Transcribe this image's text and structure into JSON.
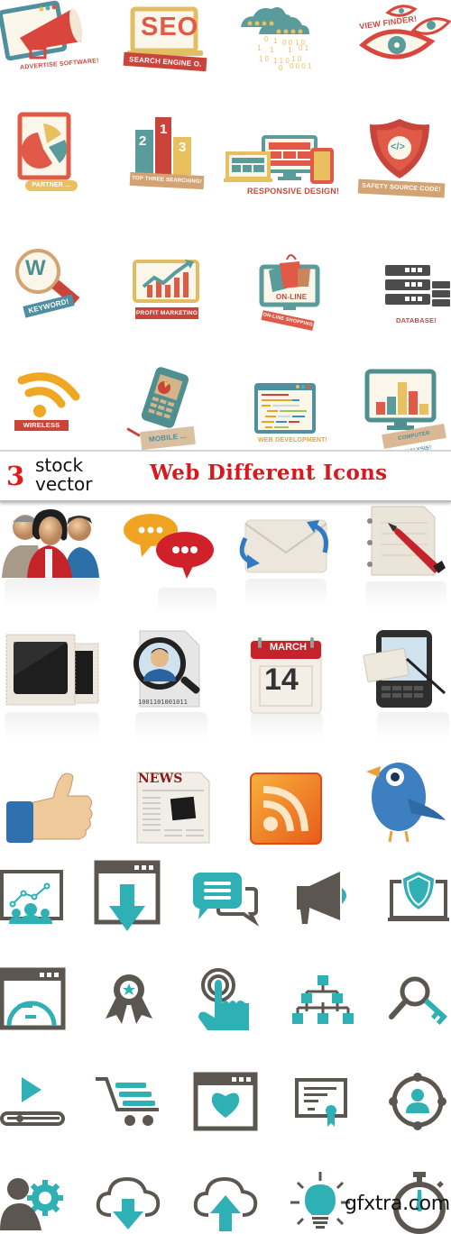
{
  "header": {
    "brand_number": "3",
    "brand_text_line1": "stock",
    "brand_text_line2": "vector",
    "title": "Web Different Icons"
  },
  "watermark": "gfxtra.com",
  "colors": {
    "retro_red": "#e05a47",
    "retro_teal": "#4f9a9b",
    "retro_yellow": "#e9c05f",
    "retro_tan": "#d9b48a",
    "flat_dark": "#5b5650",
    "flat_teal": "#2fb0b4",
    "title_red": "#d71920"
  },
  "retro_icons": [
    {
      "icon": "megaphone-window-icon",
      "label": "ADVERTISE SOFTWARE!"
    },
    {
      "icon": "seo-laptop-icon",
      "label": "SEARCH ENGINE O.",
      "screen_text": "SEO"
    },
    {
      "icon": "binary-cloud-icon",
      "label": ""
    },
    {
      "icon": "eyes-icon",
      "label": "VIEW FINDER!"
    },
    {
      "icon": "tablet-pie-chart-icon",
      "label": "PARTNER ..."
    },
    {
      "icon": "podium-icon",
      "label": "TOP THREE SEARCHING!",
      "ranks": [
        "2",
        "1",
        "3"
      ]
    },
    {
      "icon": "responsive-devices-icon",
      "label": "RESPONSIVE DESIGN!"
    },
    {
      "icon": "shield-code-icon",
      "label": "SAFETY SOURCE CODE!",
      "code": "</>"
    },
    {
      "icon": "magnifier-w-icon",
      "label": "KEYWORD!",
      "letter": "W"
    },
    {
      "icon": "growth-chart-laptop-icon",
      "label": "PROFIT MARKETING"
    },
    {
      "icon": "shopping-monitor-icon",
      "label": "ON-LINE SHOPPING",
      "screen_text": "ON-LINE"
    },
    {
      "icon": "database-servers-icon",
      "label": "DATABASE!"
    },
    {
      "icon": "wifi-icon",
      "label": "WIRELESS"
    },
    {
      "icon": "mobile-phone-icon",
      "label": "MOBILE ..."
    },
    {
      "icon": "code-window-icon",
      "label": "WEB DEVELOPMENT!"
    },
    {
      "icon": "monitor-bar-chart-icon",
      "label": "COMPUTER ANALYSIS!"
    }
  ],
  "glossy_icons": [
    {
      "icon": "people-group-icon"
    },
    {
      "icon": "chat-bubbles-icon"
    },
    {
      "icon": "mail-sync-icon"
    },
    {
      "icon": "notepad-pencil-icon"
    },
    {
      "icon": "photo-frames-icon"
    },
    {
      "icon": "user-search-icon",
      "binary": "1001101001011"
    },
    {
      "icon": "calendar-icon",
      "month": "MARCH",
      "day": "14"
    },
    {
      "icon": "phone-mail-icon"
    },
    {
      "icon": "thumbs-up-icon"
    },
    {
      "icon": "newspaper-icon",
      "headline": "NEWS"
    },
    {
      "icon": "rss-icon"
    },
    {
      "icon": "blue-bird-icon"
    }
  ],
  "flat_icons": [
    {
      "icon": "presentation-team-icon"
    },
    {
      "icon": "browser-download-icon"
    },
    {
      "icon": "chat-icon"
    },
    {
      "icon": "megaphone-icon"
    },
    {
      "icon": "laptop-shield-icon"
    },
    {
      "icon": "browser-speedometer-icon"
    },
    {
      "icon": "award-ribbon-icon"
    },
    {
      "icon": "touch-finger-icon"
    },
    {
      "icon": "sitemap-icon"
    },
    {
      "icon": "search-key-icon"
    },
    {
      "icon": "video-player-icon"
    },
    {
      "icon": "shopping-cart-icon"
    },
    {
      "icon": "browser-heart-icon"
    },
    {
      "icon": "certificate-icon"
    },
    {
      "icon": "user-target-icon"
    },
    {
      "icon": "user-settings-icon"
    },
    {
      "icon": "cloud-download-icon"
    },
    {
      "icon": "cloud-upload-icon"
    },
    {
      "icon": "light-bulb-icon"
    },
    {
      "icon": "stopwatch-icon"
    }
  ]
}
